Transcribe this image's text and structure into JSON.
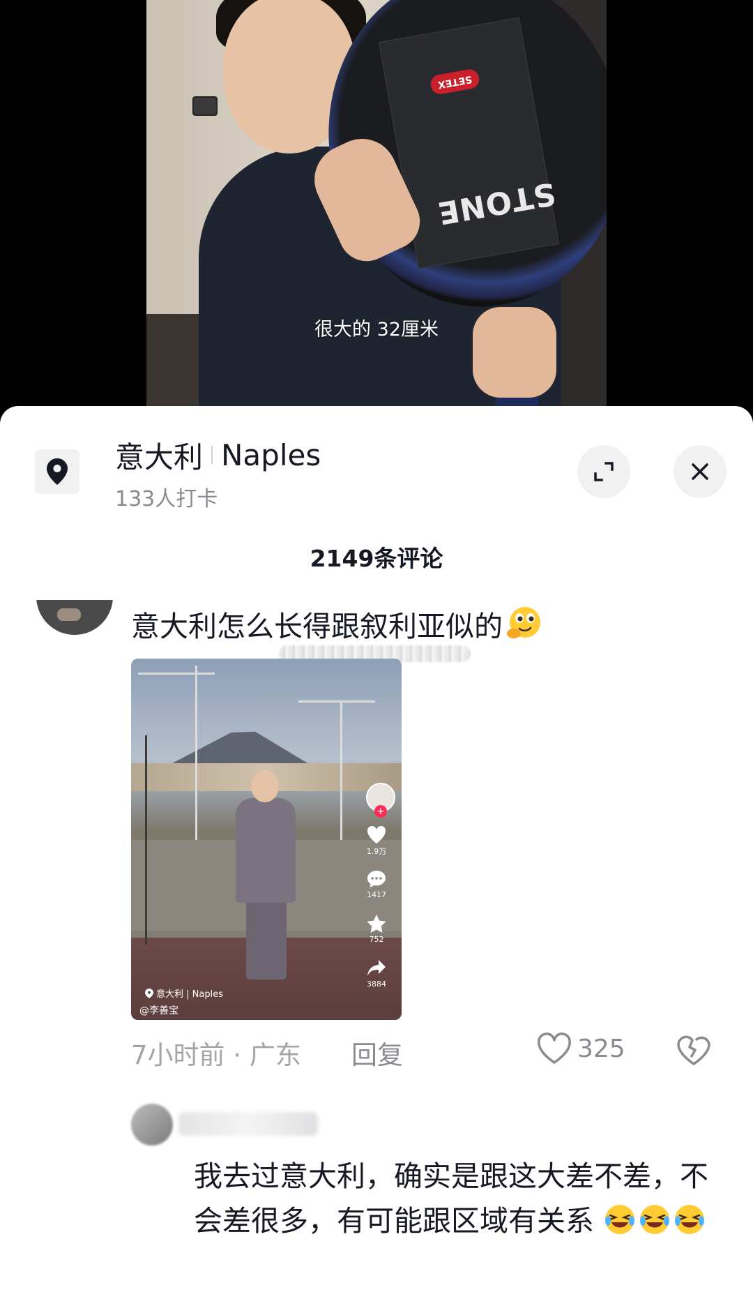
{
  "video": {
    "subtitle": "很大的 32厘米",
    "pan_brand": "STONE",
    "pan_badge": "SETEX"
  },
  "sheet": {
    "location": {
      "country": "意大利",
      "city": "Naples",
      "checkins": "133人打卡",
      "icon": "location-pin-icon"
    },
    "expand_icon": "expand-icon",
    "close_icon": "close-icon",
    "comment_count": "2149条评论"
  },
  "comment1": {
    "text": "意大利怎么长得跟叙利亚似的",
    "emoji": "thinking-face-emoji",
    "attachment": {
      "location": "意大利 | Naples",
      "author": "@李善宝",
      "likes": "1.9万",
      "comments": "1417",
      "favorites": "752",
      "shares": "3884"
    },
    "time": "7小时前 · 广东",
    "reply_label": "回复",
    "like_count": "325",
    "like_icon": "heart-icon",
    "dislike_icon": "broken-heart-icon"
  },
  "comment2": {
    "text": "我去过意大利，确实是跟这大差不差，不会差很多，有可能跟区域有关系",
    "emoji": "rolling-laughing-emoji"
  },
  "colors": {
    "sheet_bg": "#ffffff",
    "primary_text": "#161823",
    "secondary_text": "#8a8b91",
    "button_bg": "#f1f1f2",
    "accent": "#fe2c55"
  }
}
